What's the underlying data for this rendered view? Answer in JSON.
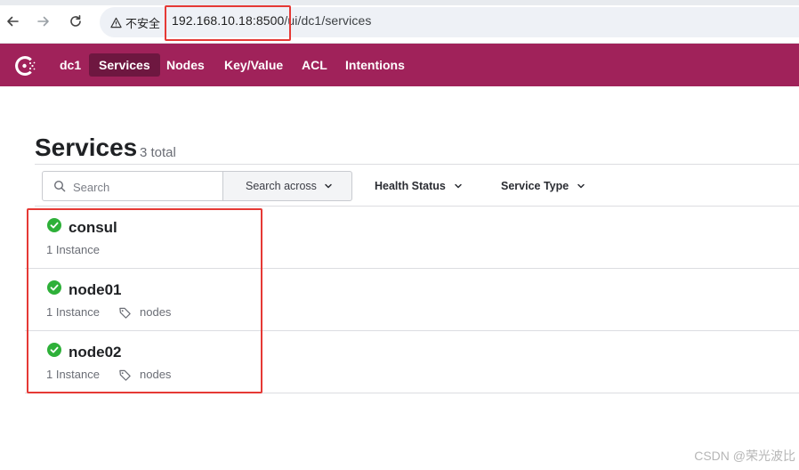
{
  "browser": {
    "security_label": "不安全",
    "url_host": "192.168.10.18:8500",
    "url_path": "/ui/dc1/services",
    "icons": [
      "back-arrow-icon",
      "forward-arrow-icon",
      "reload-icon",
      "warning-icon"
    ]
  },
  "header": {
    "datacenter": "dc1",
    "nav": [
      {
        "label": "Services",
        "active": true
      },
      {
        "label": "Nodes",
        "active": false
      },
      {
        "label": "Key/Value",
        "active": false
      },
      {
        "label": "ACL",
        "active": false
      },
      {
        "label": "Intentions",
        "active": false
      }
    ],
    "brand_color": "#a0225a",
    "active_color": "#6e1740"
  },
  "page": {
    "title": "Services",
    "count": "3 total"
  },
  "toolbar": {
    "search_placeholder": "Search",
    "search_across": "Search across",
    "health_status": "Health Status",
    "service_type": "Service Type"
  },
  "services": [
    {
      "name": "consul",
      "instances": "1 Instance",
      "tag": "",
      "status": "passing"
    },
    {
      "name": "node01",
      "instances": "1 Instance",
      "tag": "nodes",
      "status": "passing"
    },
    {
      "name": "node02",
      "instances": "1 Instance",
      "tag": "nodes",
      "status": "passing"
    }
  ],
  "status_color": "#2eb039",
  "watermark": "CSDN @荣光波比"
}
